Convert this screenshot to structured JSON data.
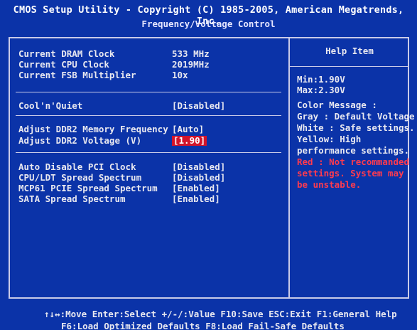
{
  "header": {
    "title": "CMOS Setup Utility - Copyright (C) 1985-2005, American Megatrends, Inc.",
    "subtitle": "Frequency/Voltage Control"
  },
  "info": {
    "dram_clock_label": "Current DRAM Clock",
    "dram_clock_value": "533 MHz",
    "cpu_clock_label": "Current CPU Clock",
    "cpu_clock_value": "2019MHz",
    "fsb_mult_label": "Current FSB Multiplier",
    "fsb_mult_value": "10x"
  },
  "settings": {
    "coolnquiet_label": "Cool'n'Quiet",
    "coolnquiet_value": "[Disabled]",
    "ddr2_freq_label": "Adjust DDR2 Memory Frequency",
    "ddr2_freq_value": "[Auto]",
    "ddr2_volt_label": "Adjust DDR2 Voltage (V)",
    "ddr2_volt_value": "[1.90]",
    "pci_clock_label": "Auto Disable PCI Clock",
    "pci_clock_value": "[Disabled]",
    "ldt_ss_label": "CPU/LDT Spread Spectrum",
    "ldt_ss_value": "[Disabled]",
    "mcp61_ss_label": "MCP61 PCIE Spread Spectrum",
    "mcp61_ss_value": "[Enabled]",
    "sata_ss_label": "SATA Spread Spectrum",
    "sata_ss_value": "[Enabled]"
  },
  "help": {
    "title": "Help Item",
    "min": "Min:1.90V",
    "max": "Max:2.30V",
    "color_msg": "Color Message :",
    "gray": "Gray : Default Voltage",
    "white": "White : Safe settings.",
    "yellow": "Yellow: High",
    "yellow2": "performance settings.",
    "red1": "Red : Not recommanded",
    "red2": "settings. System may",
    "red3": "be unstable."
  },
  "footer": {
    "line1": "↑↓↔:Move  Enter:Select  +/-/:Value  F10:Save  ESC:Exit  F1:General Help",
    "line2": "F6:Load Optimized Defaults          F8:Load Fail-Safe Defaults"
  },
  "colors": {
    "background": "#0b33a8",
    "highlight": "#d3142a",
    "red_text": "#ff3b4f"
  }
}
